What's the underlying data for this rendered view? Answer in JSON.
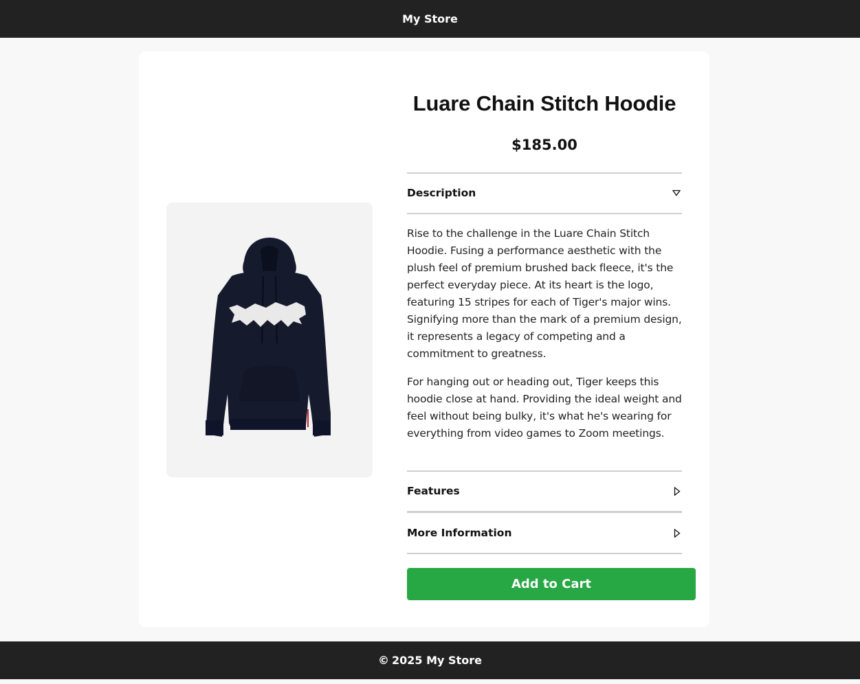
{
  "header": {
    "store_name": "My Store"
  },
  "product": {
    "title": "Luare Chain Stitch Hoodie",
    "price": "$185.00",
    "image_icon": "hoodie-product-image",
    "accordion": [
      {
        "label": "Description",
        "state": "expanded",
        "icon": "triangle-down-icon",
        "paragraphs": [
          "Rise to the challenge in the Luare Chain Stitch Hoodie. Fusing a performance aesthetic with the plush feel of premium brushed back fleece, it's the perfect everyday piece. At its heart is the logo, featuring 15 stripes for each of Tiger's major wins. Signifying more than the mark of a premium design, it represents a legacy of competing and a commitment to greatness.",
          "For hanging out or heading out, Tiger keeps this hoodie close at hand. Providing the ideal weight and feel without being bulky, it's what he's wearing for everything from video games to Zoom meetings."
        ]
      },
      {
        "label": "Features",
        "state": "collapsed",
        "icon": "triangle-right-icon"
      },
      {
        "label": "More Information",
        "state": "collapsed",
        "icon": "triangle-right-icon"
      }
    ],
    "add_to_cart_label": "Add to Cart"
  },
  "footer": {
    "copyright_symbol": "©",
    "text": "2025 My Store"
  },
  "colors": {
    "bar_background": "#222222",
    "page_background": "#f8f8f8",
    "accent_green": "#28a745",
    "divider": "#cfcfcf"
  }
}
